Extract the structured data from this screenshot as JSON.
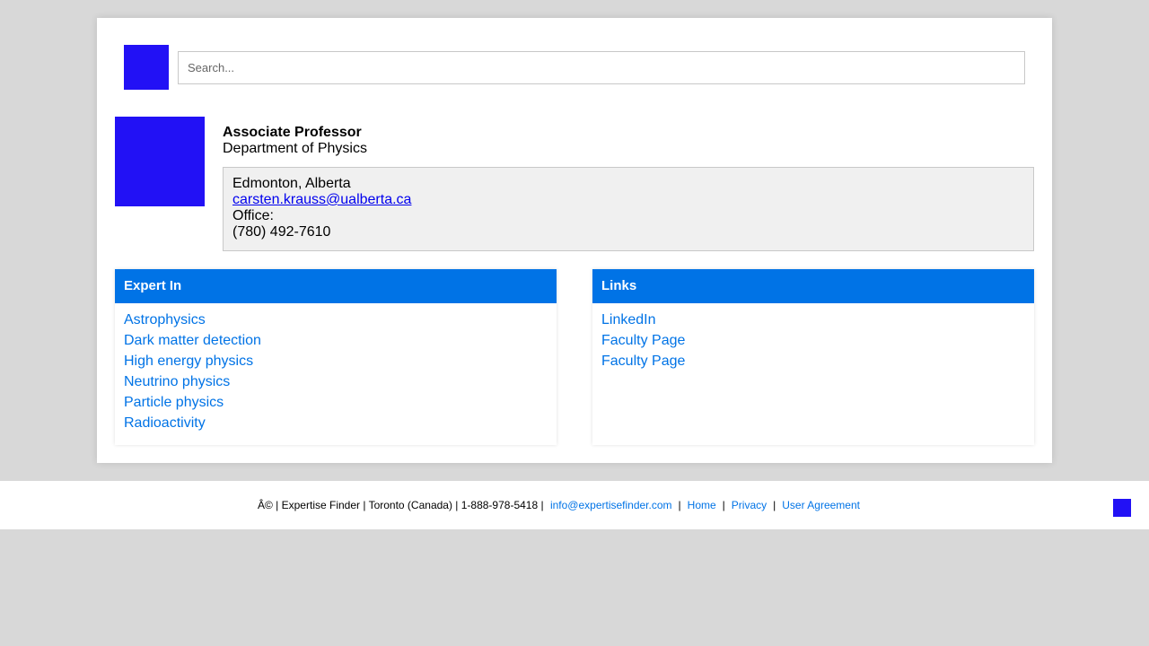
{
  "search": {
    "placeholder": "Search..."
  },
  "profile": {
    "title": "Associate Professor",
    "department": "Department of Physics",
    "location": "Edmonton, Alberta",
    "email": "carsten.krauss@ualberta.ca",
    "office_label": "Office:",
    "phone": "(780) 492-7610"
  },
  "expert_in": {
    "heading": "Expert In",
    "items": [
      "Astrophysics",
      "Dark matter detection",
      "High energy physics",
      "Neutrino physics",
      "Particle physics",
      "Radioactivity"
    ]
  },
  "links": {
    "heading": "Links",
    "items": [
      "LinkedIn",
      "Faculty Page",
      "Faculty Page"
    ]
  },
  "footer": {
    "text": "Â© | Expertise Finder | Toronto (Canada) | 1-888-978-5418 |",
    "email": "info@expertisefinder.com",
    "sep": "|",
    "home": "Home",
    "privacy": "Privacy",
    "user_agreement": "User Agreement"
  },
  "colors": {
    "accent": "#0073e6",
    "placeholder_block": "#2211f5",
    "page_bg": "#d8d8d8"
  }
}
